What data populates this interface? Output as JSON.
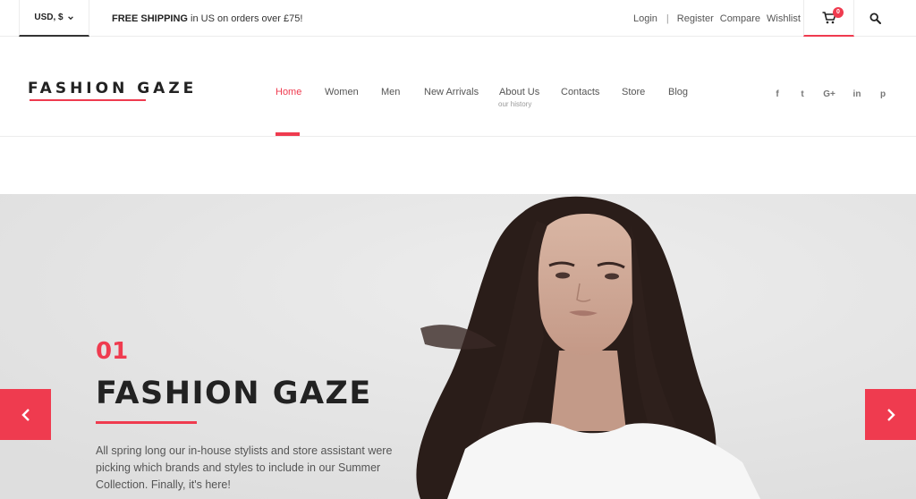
{
  "topbar": {
    "currency": "USD, $",
    "shipping_bold": "FREE SHIPPING",
    "shipping_rest": " in US on orders over £75!",
    "links": {
      "login": "Login",
      "separator": "|",
      "register": "Register",
      "compare": "Compare",
      "wishlist": "Wishlist"
    },
    "cart_count": "0",
    "icons": {
      "cart": "cart-icon",
      "search": "search-icon",
      "currency_chevron": "chevron-down-icon"
    }
  },
  "header": {
    "logo": "FASHION GAZE",
    "nav": [
      {
        "label": "Home",
        "active": true
      },
      {
        "label": "Women"
      },
      {
        "label": "Men"
      },
      {
        "label": "New Arrivals"
      },
      {
        "label": "About Us",
        "sub": "our history"
      },
      {
        "label": "Contacts"
      },
      {
        "label": "Store"
      },
      {
        "label": "Blog"
      }
    ],
    "social": [
      {
        "icon": "facebook-icon",
        "glyph": "f"
      },
      {
        "icon": "twitter-icon",
        "glyph": "t"
      },
      {
        "icon": "google-plus-icon",
        "glyph": "G+"
      },
      {
        "icon": "linkedin-icon",
        "glyph": "in"
      },
      {
        "icon": "pinterest-icon",
        "glyph": "p"
      }
    ]
  },
  "hero": {
    "number": "01",
    "title": "FASHION GAZE",
    "description": "All spring long our in-house stylists and store assistant were picking which brands and styles to include in our Summer Collection. Finally, it's here!",
    "prev_icon": "chevron-left-icon",
    "next_icon": "chevron-right-icon"
  },
  "colors": {
    "accent": "#ef3b4f",
    "text_dark": "#222222",
    "hero_bg": "#e6e6e6"
  }
}
